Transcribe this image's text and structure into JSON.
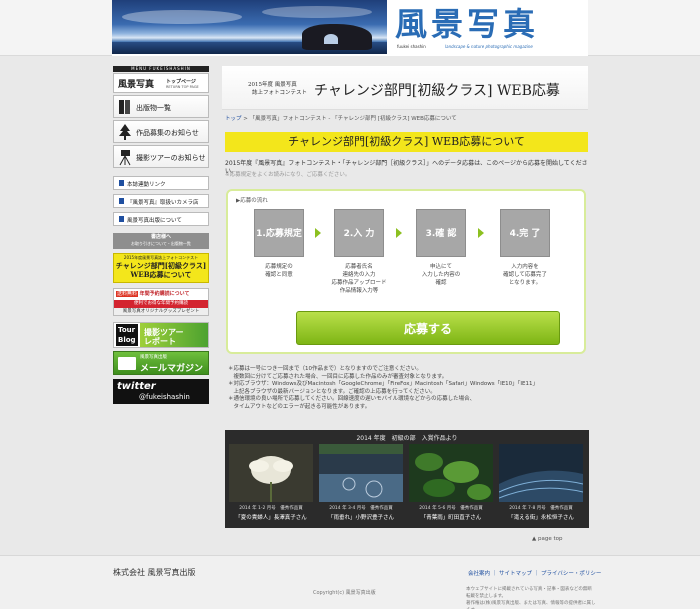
{
  "header": {
    "logo_title": "風景写真",
    "logo_sub_left": "fuukei shashin",
    "logo_sub_right": "landscape & nature photographic magazine"
  },
  "sidebar": {
    "top_bar": "MENU FUKEISHASHIN",
    "home_title": "風景写真",
    "home_label": "トップページ",
    "home_sub": "RETURN TOP PAGE",
    "items": [
      {
        "label": "出版物一覧",
        "icon": "book-icon"
      },
      {
        "label": "作品募集のお知らせ",
        "icon": "tree-icon"
      },
      {
        "label": "撮影ツアーのお知らせ",
        "icon": "camera-tripod-icon"
      }
    ],
    "links": [
      {
        "label": "本誌連動リンク"
      },
      {
        "label": "『風景写真』取扱いカメラ店"
      },
      {
        "label": "風景写真出版について"
      }
    ],
    "shop_title": "書店様へ",
    "shop_sub": "お取り引きについて・出版物一覧",
    "contest_banner_line1": "2015年度風景写真誌上フォトコンテスト",
    "contest_banner_line2": "チャレンジ部門[初級クラス]",
    "contest_banner_line3": "WEB応募について",
    "sub_banner_badge": "送料無料",
    "sub_banner_title": "年間予約購読について",
    "sub_banner_line2": "便利でお得な年間予約購読",
    "sub_banner_line3": "風景写真オリジナルグッズプレゼント",
    "tour_badge": "Tour Blog",
    "tour_label_1": "撮影ツアー",
    "tour_label_2": "レポート",
    "mail_small": "風景写真出版",
    "mail_label": "メールマガジン",
    "twitter_label": "twitter",
    "twitter_handle": "@fukeishashin"
  },
  "main": {
    "banner_small1": "2015年度 風景写真",
    "banner_small2": "誌上フォトコンテスト",
    "banner_title": "チャレンジ部門[初級クラス] WEB応募",
    "breadcrumb_home": "トップ",
    "breadcrumb_rest": " > 「風景写真」フォトコンテスト - 「チャレンジ部門 [初級クラス] WEB応募について",
    "section_title": "チャレンジ部門[初級クラス] WEB応募について",
    "intro": "2015年度『風景写真』フォトコンテスト・「チャレンジ部門［初級クラス］」へのデータ応募は、このページから応募を開始してください。",
    "intro_note": "※応募規定をよくお読みになり、ご応募ください。",
    "flow_label": "▶応募の流れ",
    "steps": [
      {
        "label": "1.応募規定",
        "desc1": "応募規定の",
        "desc2": "確認と同意",
        "desc3": "",
        "desc4": ""
      },
      {
        "label": "2.入 力",
        "desc1": "応募者氏名",
        "desc2": "連絡先の入力",
        "desc3": "応募作品アップロード",
        "desc4": "作品情報入力等"
      },
      {
        "label": "3.確 認",
        "desc1": "申込にて",
        "desc2": "入力した内容の",
        "desc3": "確認",
        "desc4": ""
      },
      {
        "label": "4.完 了",
        "desc1": "入力内容を",
        "desc2": "確認して応募完了",
        "desc3": "となります。",
        "desc4": ""
      }
    ],
    "apply_button": "応募する",
    "notes": [
      "＊応募は一号につき一回まで（10作品まで）となりますのでご注意ください。",
      "　複数回に分けてご応募された場合、一回目に応募した作品のみが審査対象となります。",
      "＊対応ブラウザ：Windows及びMacintosh「GoogleChrome」「FireFox」Macintosh「Safari」Windows「IE10」「IE11」",
      "　上記各ブラウザの最新バージョンとなります。ご確認の上応募を行ってください。",
      "＊通信環境の良い場所で応募してください。回線速度の遅いモバイル環境などからの応募した場合、",
      "　タイムアウトなどのエラーが起きる可能性があります。"
    ],
    "gallery_title": "2014 年度　初級の部　入賞作品より",
    "gallery": [
      {
        "cap1": "2014 年 1-2 月号　優秀作品賞",
        "cap2": "「夏の貴婦人」長澤真子さん"
      },
      {
        "cap1": "2014 年 3-4 月号　優秀作品賞",
        "cap2": "「雨垂れ」小野沢豊子さん"
      },
      {
        "cap1": "2014 年 5-6 月号　優秀作品賞",
        "cap2": "「青葉雨」町田直子さん"
      },
      {
        "cap1": "2014 年 7-8 月号　優秀作品賞",
        "cap2": "「滝える街」永松恒子さん"
      }
    ],
    "page_top": "▲ page top"
  },
  "footer": {
    "company": "株式会社 風景写真出版",
    "links": "会社案内 ｜ サイトマップ ｜ プライバシー・ポリシー",
    "copyright": "Copyright(c) 風景写真出版",
    "legal1": "本ウェブサイトに掲載されている写真・記事・図表などの無断転載を禁止します。",
    "legal2": "著作権は(株)風景写真出版、または写真、情報等の提供者に属します。"
  }
}
